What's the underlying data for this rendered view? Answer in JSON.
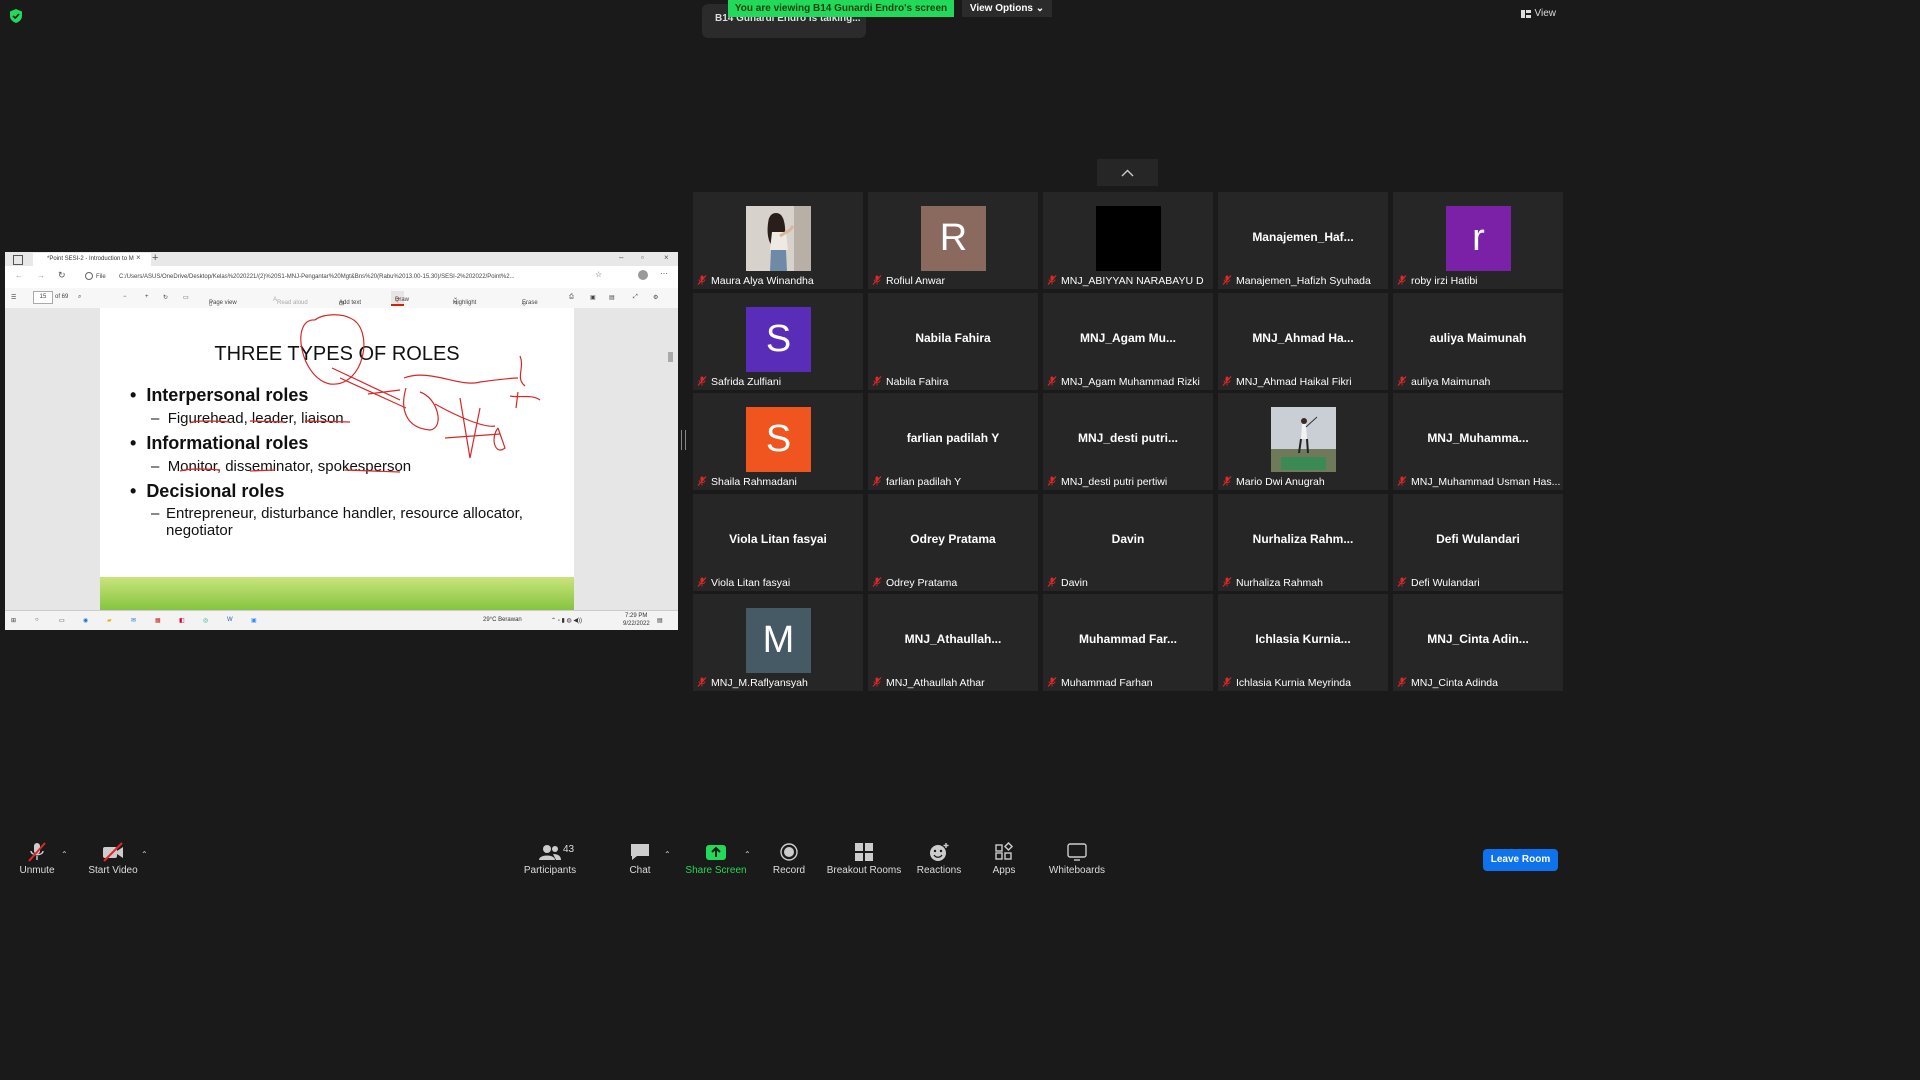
{
  "top": {
    "viewing_banner": "You are viewing B14 Gunardi Endro's screen",
    "view_options": "View Options",
    "talking": "B14 Gunardi Endro is talking...",
    "view_button": "View"
  },
  "shared_screen": {
    "tab_title": "*Point SESI-2 - Introduction to M",
    "url_prefix": "File",
    "url": "C:/Users/ASUS/OneDrive/Desktop/Kelas%2020221/(2)%20S1-MNJ-Pengantar%20Mgt&Bns%20(Rabu%2013.00-15.30)/SESI-2%202022/Point%2...",
    "page_number": "15",
    "page_total": "of 69",
    "tools": [
      "Page view",
      "Read aloud",
      "Add text",
      "Draw",
      "Highlight",
      "Erase"
    ],
    "slide": {
      "title": "THREE TYPES OF ROLES",
      "bullets": [
        {
          "label": "Interpersonal roles",
          "sub": "Figurehead, leader, liaison"
        },
        {
          "label": "Informational roles",
          "sub": "Monitor, disseminator, spokesperson"
        },
        {
          "label": "Decisional roles",
          "sub": "Entrepreneur, disturbance handler, resource allocator, negotiator"
        }
      ]
    },
    "taskbar": {
      "weather": "29°C  Berawan",
      "time": "7:29 PM",
      "date": "9/22/2022"
    }
  },
  "participants_gallery": [
    {
      "name": "Maura Alya Winandha",
      "display": "photo",
      "photo": "person"
    },
    {
      "name": "Rofiul Anwar",
      "display": "avatar",
      "initial": "R",
      "color": "#8a6a5e"
    },
    {
      "name": "MNJ_ABIYYAN NARABAYU D",
      "display": "black"
    },
    {
      "name": "Manajemen_Hafizh Syuhada",
      "display": "name",
      "short": "Manajemen_Haf..."
    },
    {
      "name": "roby irzi Hatibi",
      "display": "avatar",
      "initial": "r",
      "color": "#7b21a8"
    },
    {
      "name": "Safrida Zulfiani",
      "display": "avatar",
      "initial": "S",
      "color": "#5a2db8"
    },
    {
      "name": "Nabila Fahira",
      "display": "name",
      "short": "Nabila Fahira"
    },
    {
      "name": "MNJ_Agam Muhammad Rizki",
      "display": "name",
      "short": "MNJ_Agam  Mu..."
    },
    {
      "name": "MNJ_Ahmad Haikal Fikri",
      "display": "name",
      "short": "MNJ_Ahmad  Ha..."
    },
    {
      "name": "auliya Maimunah",
      "display": "name",
      "short": "auliya Maimunah"
    },
    {
      "name": "Shaila Rahmadani",
      "display": "avatar",
      "initial": "S",
      "color": "#f0551f"
    },
    {
      "name": "farlian padilah Y",
      "display": "name",
      "short": "farlian padilah Y"
    },
    {
      "name": "MNJ_desti putri pertiwi",
      "display": "name",
      "short": "MNJ_desti  putri..."
    },
    {
      "name": "Mario Dwi Anugrah",
      "display": "photo",
      "photo": "golf"
    },
    {
      "name": "MNJ_Muhammad Usman Has...",
      "display": "name",
      "short": "MNJ_Muhamma..."
    },
    {
      "name": "Viola Litan fasyai",
      "display": "name",
      "short": "Viola Litan fasyai"
    },
    {
      "name": "Odrey Pratama",
      "display": "name",
      "short": "Odrey Pratama"
    },
    {
      "name": "Davin",
      "display": "name",
      "short": "Davin"
    },
    {
      "name": "Nurhaliza Rahmah",
      "display": "name",
      "short": "Nurhaliza  Rahm..."
    },
    {
      "name": "Defi Wulandari",
      "display": "name",
      "short": "Defi Wulandari"
    },
    {
      "name": "MNJ_M.Raflyansyah",
      "display": "avatar",
      "initial": "M",
      "color": "#455a64"
    },
    {
      "name": "MNJ_Athaullah Athar",
      "display": "name",
      "short": "MNJ_Athaullah..."
    },
    {
      "name": "Muhammad Farhan",
      "display": "name",
      "short": "Muhammad  Far..."
    },
    {
      "name": "Ichlasia Kurnia Meyrinda",
      "display": "name",
      "short": "Ichlasia  Kurnia..."
    },
    {
      "name": "MNJ_Cinta Adinda",
      "display": "name",
      "short": "MNJ_Cinta  Adin..."
    }
  ],
  "toolbar": {
    "unmute": "Unmute",
    "start_video": "Start Video",
    "participants": "Participants",
    "participants_count": "43",
    "chat": "Chat",
    "share_screen": "Share Screen",
    "record": "Record",
    "breakout_rooms": "Breakout Rooms",
    "reactions": "Reactions",
    "apps": "Apps",
    "whiteboards": "Whiteboards",
    "leave_room": "Leave Room"
  },
  "colors": {
    "share_green": "#23d959",
    "leave_blue": "#0e72ed",
    "muted_red": "#e02828"
  }
}
